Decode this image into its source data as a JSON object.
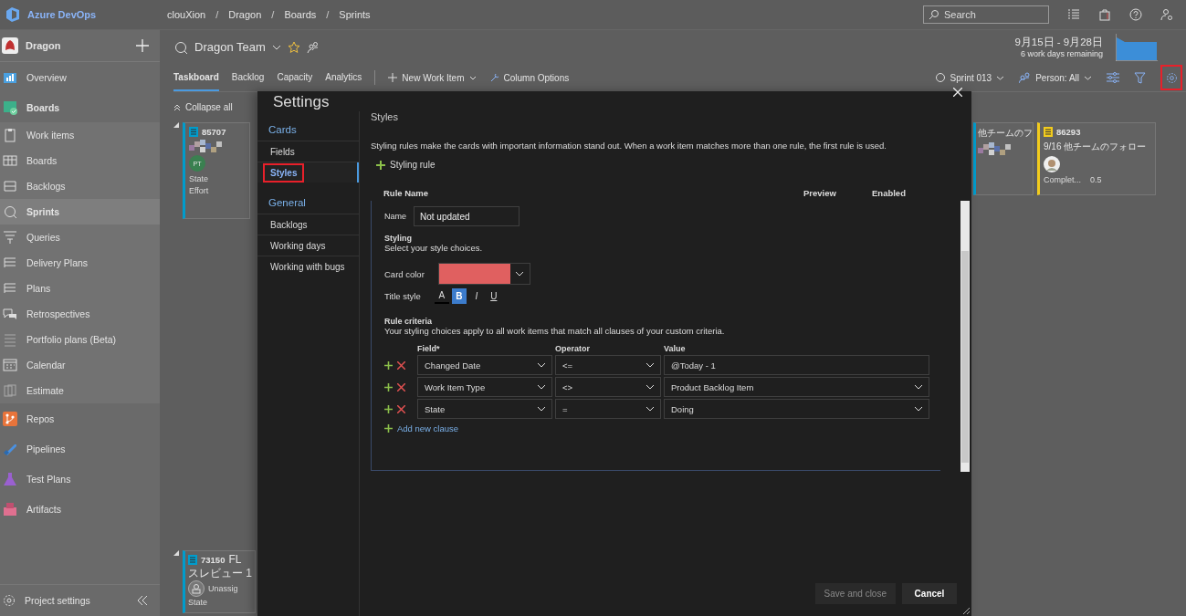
{
  "top_bar": {
    "product": "Azure DevOps",
    "breadcrumb": [
      "clouXion",
      "Dragon",
      "Boards",
      "Sprints"
    ],
    "breadcrumb_separator": "/",
    "search": {
      "placeholder": "Search"
    }
  },
  "sidebar": {
    "project": "Dragon",
    "items": [
      {
        "label": "Overview",
        "kind": "hub",
        "selected": false
      },
      {
        "label": "Boards",
        "kind": "hub",
        "selected": false
      },
      {
        "label": "Work items",
        "kind": "page",
        "selected": false
      },
      {
        "label": "Boards",
        "kind": "page",
        "selected": false
      },
      {
        "label": "Backlogs",
        "kind": "page",
        "selected": false
      },
      {
        "label": "Sprints",
        "kind": "page",
        "selected": true
      },
      {
        "label": "Queries",
        "kind": "page",
        "selected": false
      },
      {
        "label": "Delivery Plans",
        "kind": "page",
        "selected": false
      },
      {
        "label": "Plans",
        "kind": "page",
        "selected": false
      },
      {
        "label": "Retrospectives",
        "kind": "page",
        "selected": false
      },
      {
        "label": "Portfolio plans (Beta)",
        "kind": "page",
        "selected": false
      },
      {
        "label": "Calendar",
        "kind": "page",
        "selected": false
      },
      {
        "label": "Estimate",
        "kind": "page",
        "selected": false
      },
      {
        "label": "Repos",
        "kind": "hub",
        "selected": false
      },
      {
        "label": "Pipelines",
        "kind": "hub",
        "selected": false
      },
      {
        "label": "Test Plans",
        "kind": "hub",
        "selected": false
      },
      {
        "label": "Artifacts",
        "kind": "hub",
        "selected": false
      }
    ],
    "footer": "Project settings"
  },
  "header": {
    "team": "Dragon Team",
    "dates": "9月15日 - 9月28日",
    "remaining": "6 work days remaining"
  },
  "tabs": [
    {
      "label": "Taskboard",
      "selected": true
    },
    {
      "label": "Backlog",
      "selected": false
    },
    {
      "label": "Capacity",
      "selected": false
    },
    {
      "label": "Analytics",
      "selected": false
    }
  ],
  "toolbar": {
    "new_item": "New Work Item",
    "column_options": "Column Options",
    "sprint": "Sprint 013",
    "person": "Person: All",
    "settings_highlighted": true
  },
  "collapse": "Collapse all",
  "cards": [
    {
      "id": "85707",
      "pixelated": true,
      "avatar": {
        "kind": "initials",
        "text": "PT"
      },
      "fields": [
        {
          "label": "State"
        },
        {
          "label": "Effort"
        }
      ],
      "color": "#009ccc"
    },
    {
      "title": "他チームのフ",
      "pixelated": true,
      "color": "#009ccc"
    },
    {
      "id": "86293",
      "title": "9/16 他チームのフォロー",
      "avatar": {
        "kind": "photo"
      },
      "fields": [
        {
          "label": "Complet...",
          "value": "0.5"
        }
      ],
      "color": "#f2cb1d"
    },
    {
      "id": "73150",
      "title": "FL",
      "subtitle": "スレビュー 1",
      "avatar": {
        "kind": "unassigned",
        "text": "Unassig"
      },
      "fields": [
        {
          "label": "State"
        }
      ],
      "color": "#009ccc"
    }
  ],
  "dialog": {
    "title": "Settings",
    "nav": [
      {
        "group": "Cards",
        "items": [
          {
            "label": "Fields",
            "selected": false,
            "highlighted": false
          },
          {
            "label": "Styles",
            "selected": true,
            "highlighted": true
          }
        ]
      },
      {
        "group": "General",
        "items": [
          {
            "label": "Backlogs",
            "selected": false,
            "highlighted": false
          },
          {
            "label": "Working days",
            "selected": false,
            "highlighted": false
          },
          {
            "label": "Working with bugs",
            "selected": false,
            "highlighted": false
          }
        ]
      }
    ],
    "section": "Styles",
    "description": "Styling rules make the cards with important information stand out. When a work item matches more than one rule, the first rule is used.",
    "add_rule": "Styling rule",
    "columns": [
      "Rule Name",
      "Preview",
      "Enabled"
    ],
    "rule": {
      "name_label": "Name",
      "name": "Not updated",
      "styling_title": "Styling",
      "styling_hint": "Select your style choices.",
      "card_color": {
        "label": "Card color",
        "color": "#e06060"
      },
      "title_style_label": "Title style",
      "title_styles": [
        {
          "label": "A",
          "kind": "color",
          "selected": false
        },
        {
          "label": "B",
          "kind": "bold",
          "selected": true
        },
        {
          "label": "I",
          "kind": "italic",
          "selected": false
        },
        {
          "label": "U",
          "kind": "underline",
          "selected": false
        }
      ],
      "criteria_title": "Rule criteria",
      "criteria_hint": "Your styling choices apply to all work items that match all clauses of your custom criteria.",
      "criteria_columns": [
        "Field*",
        "Operator",
        "Value"
      ],
      "clauses": [
        {
          "field": "Changed Date",
          "operator": "<=",
          "value": "@Today - 1",
          "kind": "text"
        },
        {
          "field": "Work Item Type",
          "operator": "<>",
          "value": "Product Backlog Item",
          "kind": "select"
        },
        {
          "field": "State",
          "operator": "=",
          "value": "Doing",
          "kind": "select"
        }
      ],
      "add_clause": "Add new clause"
    },
    "buttons": [
      {
        "label": "Save and close",
        "disabled": true
      },
      {
        "label": "Cancel",
        "disabled": false
      }
    ]
  }
}
